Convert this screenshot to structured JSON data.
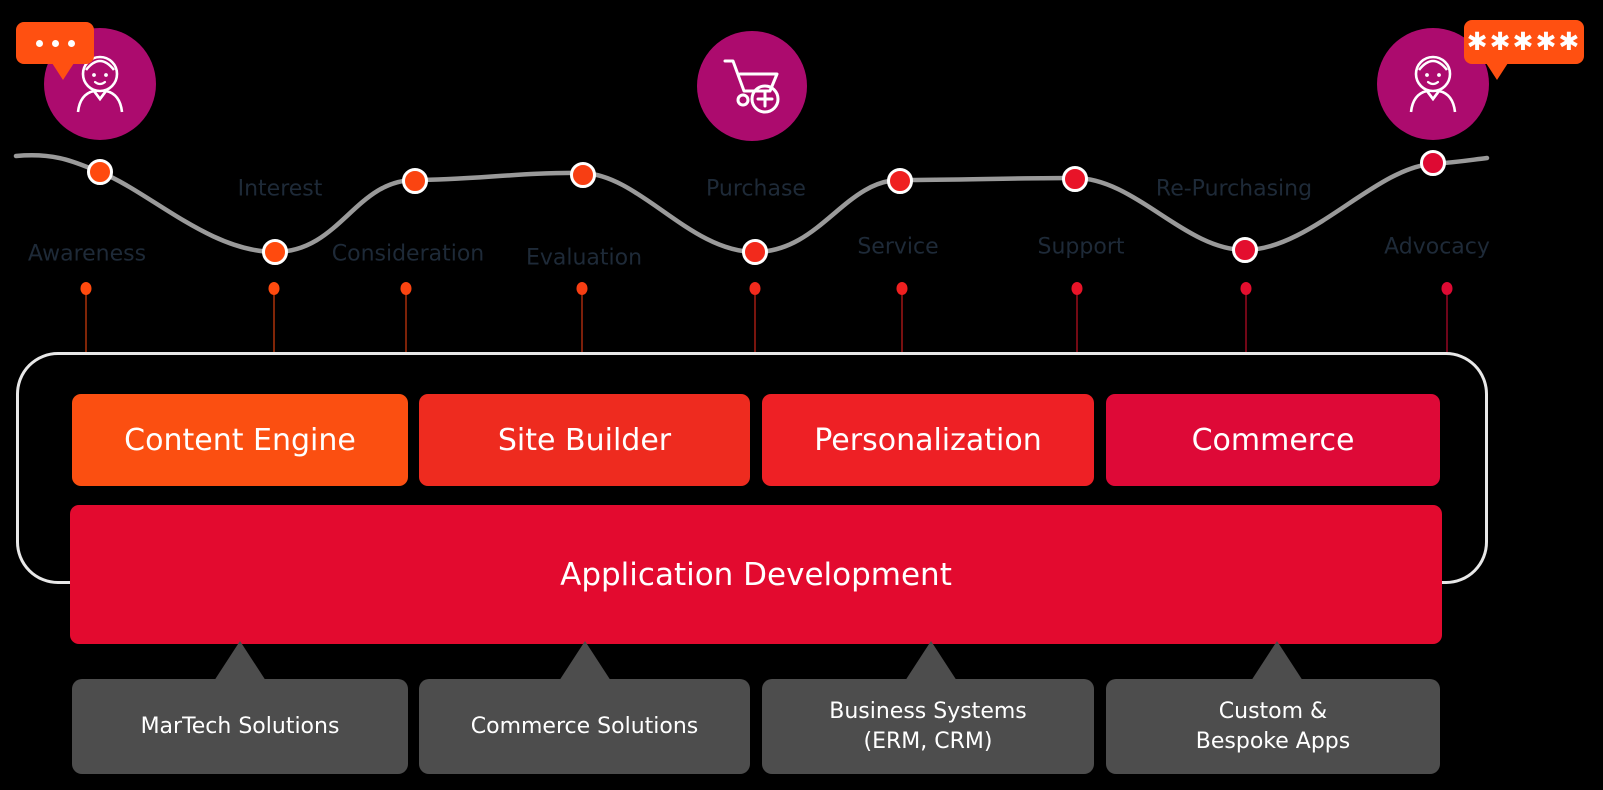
{
  "diagram": {
    "title": "Customer Journey Digital Experience Platform Stack",
    "colors": {
      "background": "#000000",
      "persona_circle": "#AC0B6E",
      "bubble": "#FF5011",
      "wave_line": "#9A9A9A",
      "frame_outline": "#E8E8E8",
      "label_text": "#1E2A38",
      "foundation_gray": "#4D4D4D",
      "appdev_red": "#E30A2F"
    }
  },
  "personas": {
    "left": {
      "icon": "person-icon",
      "bubble_icon": "chat-dots-icon",
      "bubble_text": ""
    },
    "middle": {
      "icon": "shopping-cart-add-icon"
    },
    "right": {
      "icon": "person-icon",
      "bubble_icon": "star-rating-icon",
      "bubble_text": "✱✱✱✱✱"
    }
  },
  "journey": {
    "stages": [
      {
        "label": "Awareness",
        "dot_color": "#FF4A0E",
        "knob_color": "#FF4A0E"
      },
      {
        "label": "Interest",
        "dot_color": "#FF4A0E",
        "knob_color": "#FF4A0E"
      },
      {
        "label": "Consideration",
        "dot_color": "#FA4411",
        "knob_color": "#FA4411"
      },
      {
        "label": "Evaluation",
        "dot_color": "#F73E13",
        "knob_color": "#F73E13"
      },
      {
        "label": "Purchase",
        "dot_color": "#F22A1C",
        "knob_color": "#F22A1C"
      },
      {
        "label": "Service",
        "dot_color": "#EF2020",
        "knob_color": "#EF2020"
      },
      {
        "label": "Support",
        "dot_color": "#E81428",
        "knob_color": "#E81428"
      },
      {
        "label": "Re-Purchasing",
        "dot_color": "#E30E2E",
        "knob_color": "#E30E2E"
      },
      {
        "label": "Advocacy",
        "dot_color": "#DE0A33",
        "knob_color": "#DE0A33"
      }
    ]
  },
  "platform": {
    "capabilities": [
      {
        "label": "Content Engine",
        "color": "#FB4F11"
      },
      {
        "label": "Site Builder",
        "color": "#EE2B1F"
      },
      {
        "label": "Personalization",
        "color": "#EE2025"
      },
      {
        "label": "Commerce",
        "color": "#DE0937"
      }
    ],
    "application_development": {
      "label": "Application Development"
    }
  },
  "foundation": {
    "items": [
      {
        "label": "MarTech Solutions"
      },
      {
        "label": "Commerce Solutions"
      },
      {
        "label": "Business Systems\n(ERM, CRM)"
      },
      {
        "label": "Custom &\nBespoke Apps"
      }
    ]
  }
}
